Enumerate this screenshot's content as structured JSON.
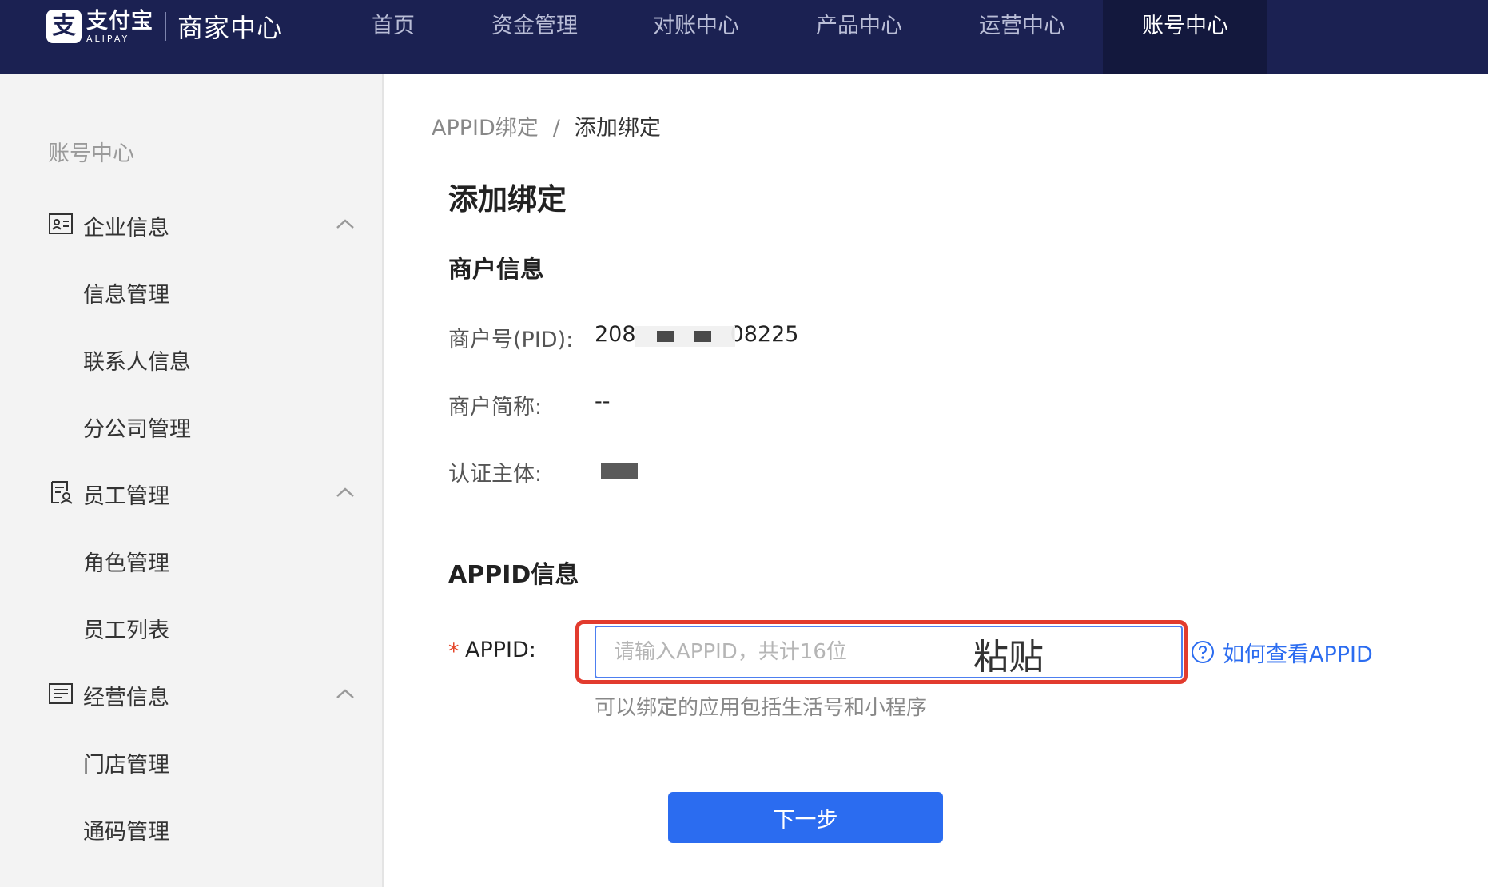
{
  "header": {
    "logo_mark": "支",
    "logo_cn": "支付宝",
    "logo_en": "ALIPAY",
    "app_title": "商家中心",
    "nav": [
      {
        "label": "首页"
      },
      {
        "label": "资金管理"
      },
      {
        "label": "对账中心"
      },
      {
        "label": "产品中心"
      },
      {
        "label": "运营中心"
      },
      {
        "label": "账号中心"
      }
    ],
    "active_nav": "账号中心"
  },
  "sidebar": {
    "title": "账号中心",
    "groups": [
      {
        "label": "企业信息",
        "icon": "id-card-icon",
        "items": [
          "信息管理",
          "联系人信息",
          "分公司管理"
        ]
      },
      {
        "label": "员工管理",
        "icon": "staff-icon",
        "items": [
          "角色管理",
          "员工列表"
        ]
      },
      {
        "label": "经营信息",
        "icon": "document-icon",
        "items": [
          "门店管理",
          "通码管理"
        ]
      }
    ]
  },
  "breadcrumb": {
    "parent": "APPID绑定",
    "separator": "/",
    "current": "添加绑定"
  },
  "page_title": "添加绑定",
  "merchant_section": {
    "title": "商户信息",
    "pid_label": "商户号(PID):",
    "pid_prefix": "208",
    "pid_suffix": "08225",
    "name_label": "商户简称:",
    "name_value": "--",
    "entity_label": "认证主体:"
  },
  "appid_section": {
    "title": "APPID信息",
    "required_mark": "*",
    "label": "APPID:",
    "value": "",
    "placeholder": "请输入APPID，共计16位",
    "annotation": "粘贴",
    "help_link": "如何查看APPID",
    "hint": "可以绑定的应用包括生活号和小程序"
  },
  "next_button": "下一步",
  "colors": {
    "topbar": "#1b2152",
    "active_nav": "#13183d",
    "primary": "#2b6cf0",
    "highlight_border": "#e23b2e",
    "required": "#e5472b"
  }
}
